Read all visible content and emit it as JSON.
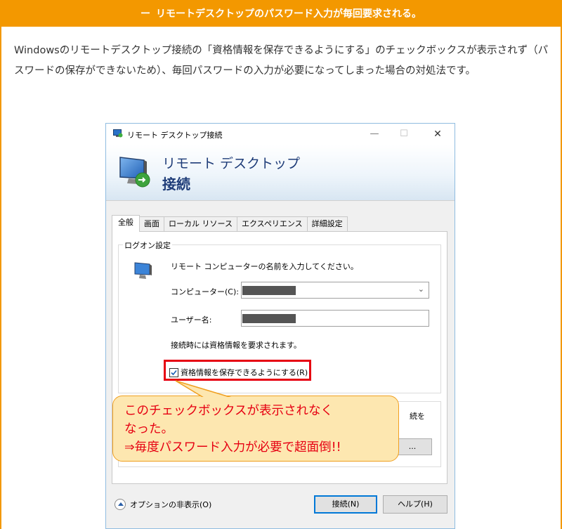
{
  "header": {
    "prefix": "ー",
    "title": "リモートデスクトップのパスワード入力が毎回要求される。"
  },
  "intro": {
    "text": "Windowsのリモートデスクトップ接続の「資格情報を保存できるようにする」のチェックボックスが表示されず（パスワードの保存ができないため）、毎回パスワードの入力が必要になってしまった場合の対処法です。"
  },
  "dialog": {
    "window_title": "リモート デスクトップ接続",
    "banner_line1": "リモート デスクトップ",
    "banner_line2": "接続",
    "tabs": [
      {
        "label": "全般",
        "active": true
      },
      {
        "label": "画面",
        "active": false
      },
      {
        "label": "ローカル リソース",
        "active": false
      },
      {
        "label": "エクスペリエンス",
        "active": false
      },
      {
        "label": "詳細設定",
        "active": false
      }
    ],
    "logon_group_title": "ログオン設定",
    "logon_instruction": "リモート コンピューターの名前を入力してください。",
    "computer_label": "コンピューター(C):",
    "username_label": "ユーザー名:",
    "credentials_note": "接続時には資格情報を要求されます。",
    "save_credentials_label": "資格情報を保存できるようにする(R)",
    "save_credentials_checked": true,
    "behind_callout_text": "続を",
    "behind_callout_button": "...",
    "options_toggle_label": "オプションの非表示(O)",
    "connect_label": "接続(N)",
    "help_label": "ヘルプ(H)",
    "window_controls": {
      "minimize": "—",
      "maximize": "☐",
      "close": "✕"
    }
  },
  "callout": {
    "line1": "このチェックボックスが表示されなく",
    "line2": "なった。",
    "line3": "⇒毎度パスワード入力が必要で超面倒!!"
  },
  "colors": {
    "accent_orange": "#f39800",
    "highlight_red": "#e60012",
    "callout_fill": "#fde7b0",
    "dialog_banner_text": "#1e3c78"
  }
}
